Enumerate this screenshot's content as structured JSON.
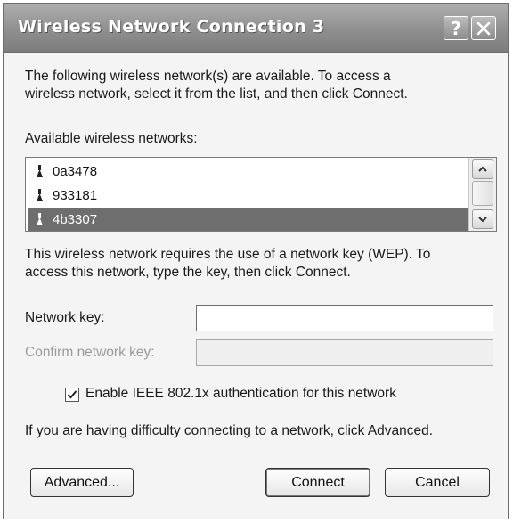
{
  "window": {
    "title": "Wireless Network Connection 3",
    "help_label": "?",
    "close_icon": "close-icon"
  },
  "intro_text": [
    "The following wireless network(s) are available. To access a",
    "wireless network, select it from the list, and then click Connect."
  ],
  "networks_label": "Available wireless networks:",
  "networks": [
    {
      "name": "0a3478",
      "icon": "wireless-antenna-icon",
      "selected": false
    },
    {
      "name": "933181",
      "icon": "wireless-antenna-icon",
      "selected": false
    },
    {
      "name": "4b3307",
      "icon": "wireless-antenna-icon",
      "selected": true
    }
  ],
  "wep_text": [
    "This wireless network requires the use of a network key (WEP). To",
    "access this network, type the key, then click Connect."
  ],
  "network_key": {
    "label": "Network key:",
    "value": ""
  },
  "confirm_key": {
    "label": "Confirm network key:",
    "value": ""
  },
  "ieee_checkbox": {
    "label": "Enable IEEE 802.1x authentication for this network",
    "checked": true
  },
  "help_text": "If you are having difficulty connecting to a network, click Advanced.",
  "buttons": {
    "advanced": "Advanced...",
    "connect": "Connect",
    "cancel": "Cancel"
  }
}
